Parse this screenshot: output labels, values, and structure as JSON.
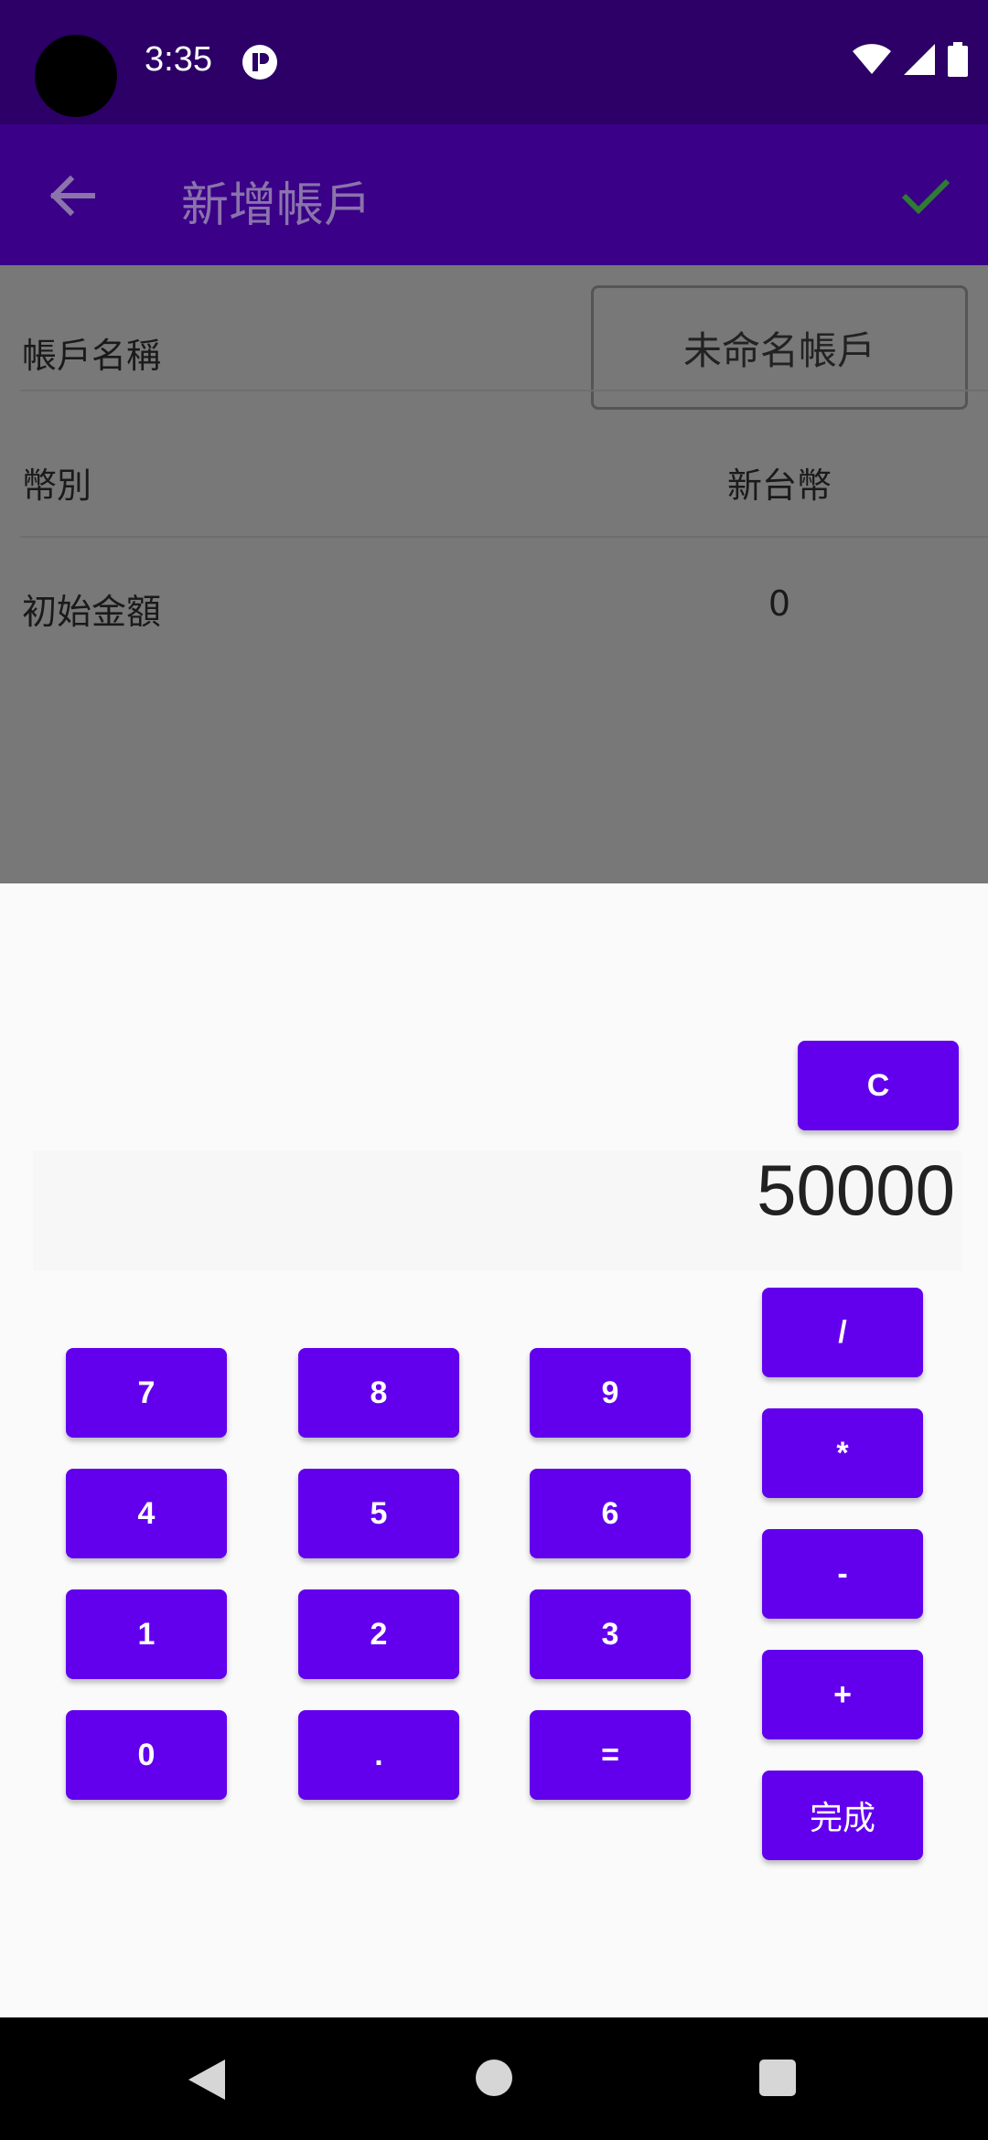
{
  "status_bar": {
    "time": "3:35",
    "icons": [
      "app-notification-icon",
      "wifi-icon",
      "cell-signal-icon",
      "battery-icon"
    ]
  },
  "app_bar": {
    "title": "新增帳戶",
    "back_icon": "arrow-left-icon",
    "confirm_icon": "check-icon"
  },
  "form": {
    "account_name_label": "帳戶名稱",
    "account_name_value": "未命名帳戶",
    "currency_label": "幣別",
    "currency_value": "新台幣",
    "initial_amount_label": "初始金額",
    "initial_amount_value": "0"
  },
  "calculator": {
    "display": "50000",
    "clear_label": "C",
    "digits": [
      "7",
      "8",
      "9",
      "4",
      "5",
      "6",
      "1",
      "2",
      "3",
      "0",
      ".",
      "="
    ],
    "operators": [
      "/",
      "*",
      "-",
      "+"
    ],
    "done_label": "完成"
  },
  "colors": {
    "status_bar": "#2c0066",
    "app_bar": "#3a0088",
    "button": "#6200ee",
    "confirm_check": "#2e7d32",
    "scrim": "#787878"
  }
}
